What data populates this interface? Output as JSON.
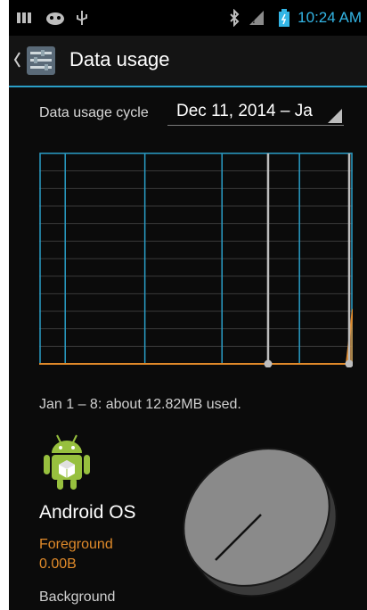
{
  "status_bar": {
    "time": "10:24 AM",
    "icons": [
      "notification-icon",
      "android-debug-icon",
      "usb-icon",
      "bluetooth-icon",
      "signal-icon",
      "battery-icon"
    ]
  },
  "action_bar": {
    "title": "Data usage",
    "icon": "data-usage-settings-icon"
  },
  "cycle": {
    "label": "Data usage cycle",
    "value": "Dec 11, 2014 – Ja"
  },
  "chart_data": {
    "type": "area",
    "title": "",
    "xlabel": "",
    "ylabel": "",
    "series": [
      {
        "x": [
          0,
          0.56,
          0.98,
          1.0
        ],
        "y": [
          0,
          0,
          0,
          0.26
        ]
      }
    ],
    "selection": [
      0.73,
      1.0
    ],
    "colors": {
      "line": "#e0892a",
      "grid": "#3a3a3a",
      "weeks": "#2a9ec7",
      "handles": "#bdbdbd"
    },
    "week_markers": [
      0.083,
      0.337,
      0.583,
      0.83
    ],
    "gridlines": 12
  },
  "summary": "Jan 1 – 8: about 12.82MB used.",
  "app": {
    "name": "Android OS",
    "icon": "android-robot-icon",
    "foreground_label": "Foreground",
    "foreground_value": "0.00B",
    "background_label": "Background"
  },
  "pie_data": {
    "type": "pie",
    "colors": {
      "fill": "#8a8a8a",
      "edge": "#3a3a3a",
      "stroke": "#1a1a1a"
    }
  }
}
